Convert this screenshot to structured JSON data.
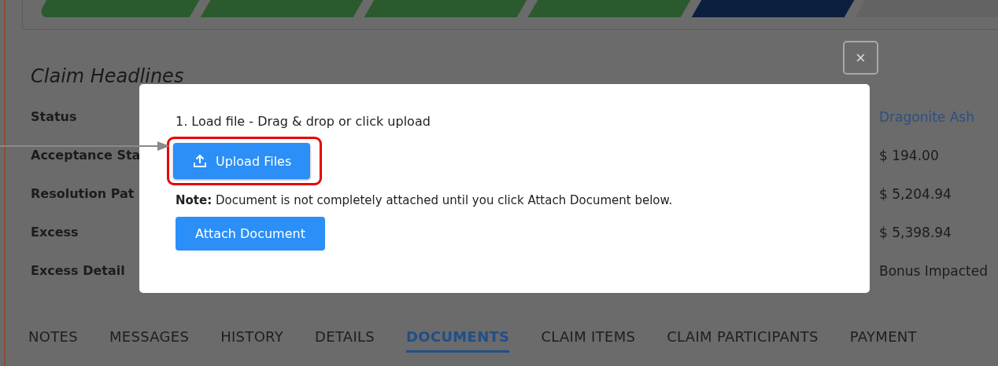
{
  "path": [
    {
      "complete": true,
      "current": false
    },
    {
      "complete": true,
      "current": false
    },
    {
      "complete": true,
      "current": false
    },
    {
      "complete": true,
      "current": false
    },
    {
      "complete": false,
      "current": true
    },
    {
      "complete": false,
      "current": false
    }
  ],
  "section": {
    "title": "Claim Headlines",
    "fields": [
      {
        "label": "Status",
        "value": "Dragonite Ash",
        "kind": "link"
      },
      {
        "label": "Acceptance Sta",
        "value": "$ 194.00",
        "kind": "text"
      },
      {
        "label": "Resolution Pat",
        "value": "$ 5,204.94",
        "kind": "text"
      },
      {
        "label": "Excess",
        "value": "$ 5,398.94",
        "kind": "text"
      },
      {
        "label": "Excess Detail",
        "value": "Bonus Impacted",
        "kind": "text"
      }
    ]
  },
  "tabs": [
    {
      "label": "NOTES",
      "selected": false
    },
    {
      "label": "MESSAGES",
      "selected": false
    },
    {
      "label": "HISTORY",
      "selected": false
    },
    {
      "label": "DETAILS",
      "selected": false
    },
    {
      "label": "DOCUMENTS",
      "selected": true
    },
    {
      "label": "CLAIM ITEMS",
      "selected": false
    },
    {
      "label": "CLAIM PARTICIPANTS",
      "selected": false
    },
    {
      "label": "PAYMENT",
      "selected": false
    }
  ],
  "modal": {
    "close_label": "×",
    "instruction": "1. Load file - Drag & drop or click upload",
    "upload_button": "Upload Files",
    "note": "**Note:** Document is not completely attached until you click Attach Document below.",
    "attach_button": "Attach Document"
  }
}
